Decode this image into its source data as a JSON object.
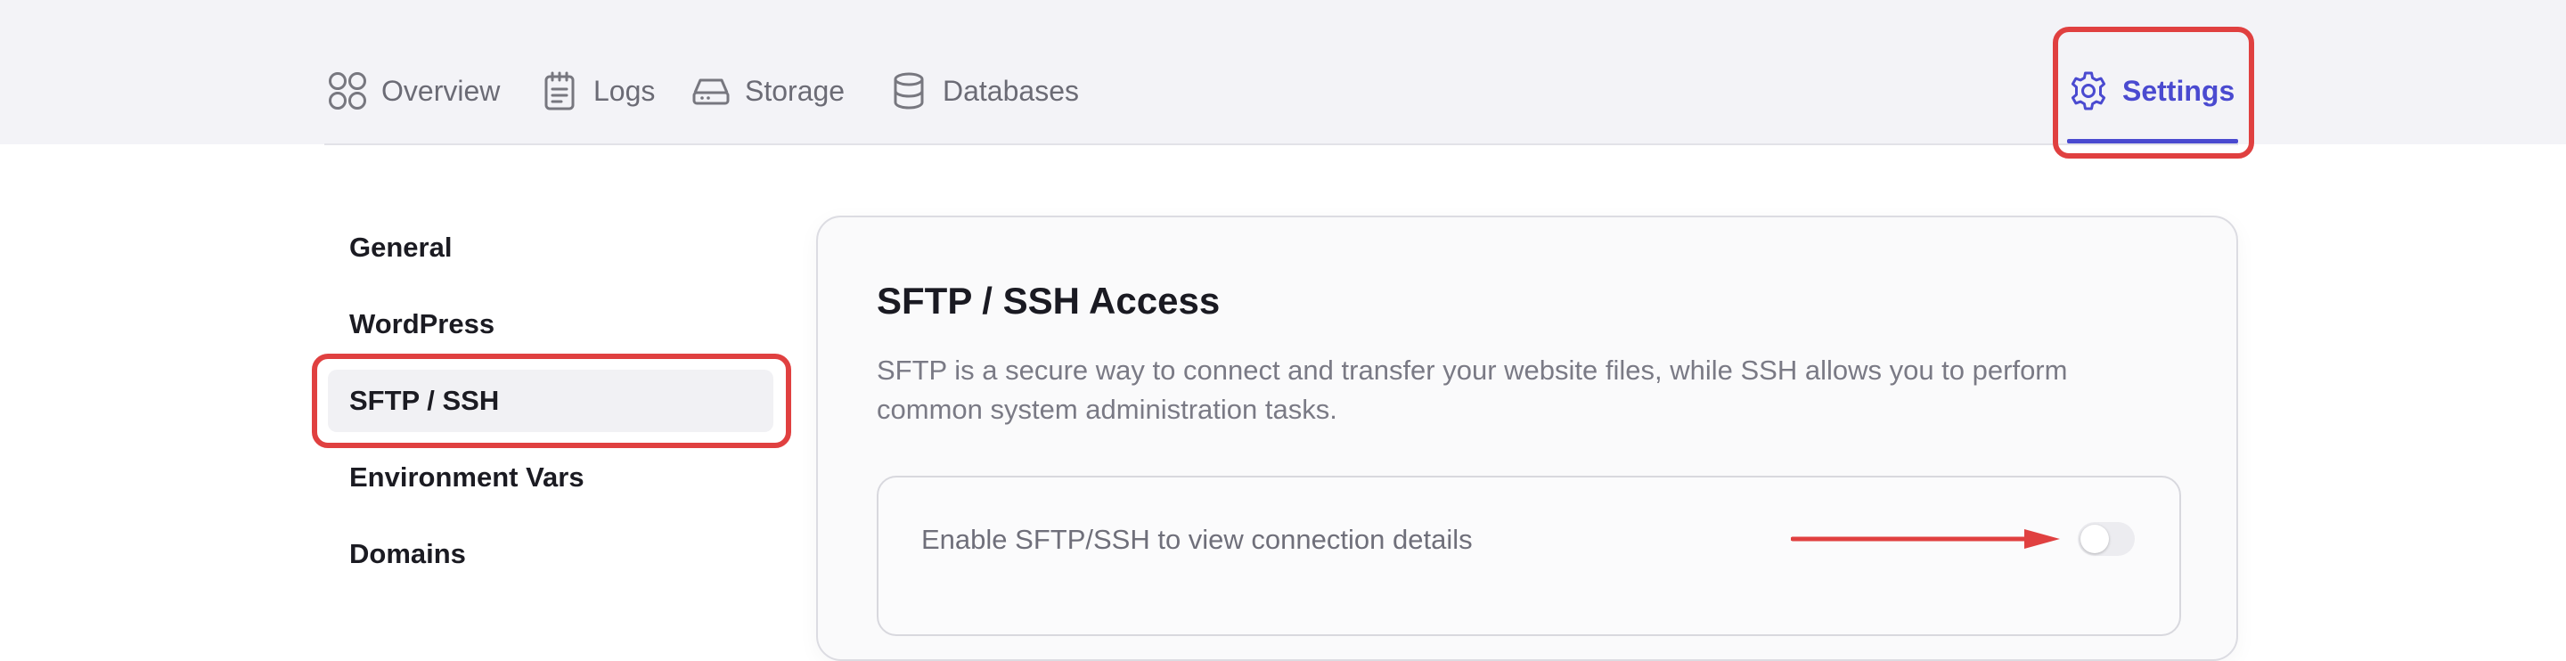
{
  "topnav": {
    "items": [
      {
        "label": "Overview",
        "icon": "overview-grid-icon"
      },
      {
        "label": "Logs",
        "icon": "clipboard-icon"
      },
      {
        "label": "Storage",
        "icon": "hard-drive-icon"
      },
      {
        "label": "Databases",
        "icon": "database-icon"
      }
    ],
    "settings": {
      "label": "Settings",
      "icon": "gear-icon",
      "active": true
    }
  },
  "sidebar": {
    "items": [
      {
        "label": "General"
      },
      {
        "label": "WordPress"
      },
      {
        "label": "SFTP / SSH",
        "active": true
      },
      {
        "label": "Environment Vars"
      },
      {
        "label": "Domains"
      }
    ]
  },
  "panel": {
    "title": "SFTP / SSH Access",
    "description": "SFTP is a secure way to connect and transfer your website files, while SSH allows you to perform common system administration tasks.",
    "toggle": {
      "label": "Enable SFTP/SSH to view connection details",
      "enabled": false
    }
  },
  "colors": {
    "accent": "#4a4ad0",
    "highlight": "#e04040"
  }
}
